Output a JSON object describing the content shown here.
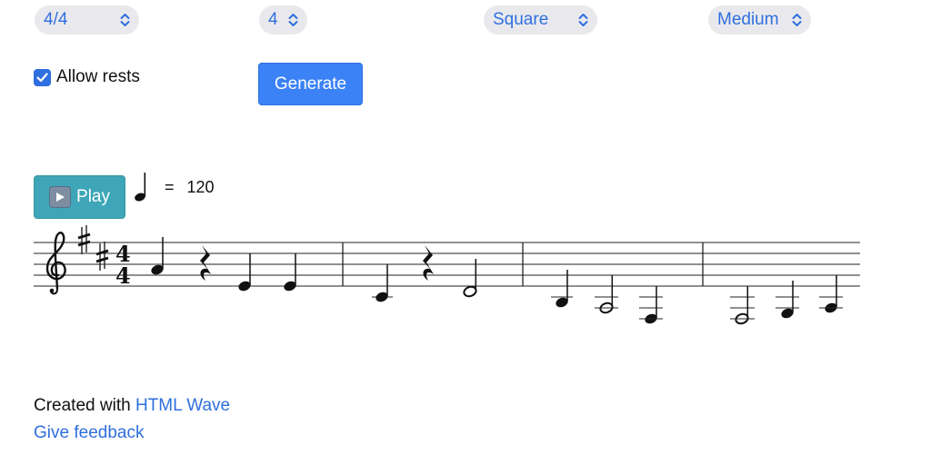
{
  "controls": {
    "time_signature": "4/4",
    "measures": "4",
    "waveform": "Square",
    "difficulty": "Medium",
    "allow_rests_label": "Allow rests",
    "allow_rests_checked": true,
    "generate_label": "Generate"
  },
  "player": {
    "play_label": "Play",
    "tempo_equals": "=",
    "tempo_value": "120"
  },
  "score": {
    "clef": "treble",
    "key_signature": "D major (2 sharps)",
    "time_signature_top": "4",
    "time_signature_bottom": "4",
    "measures": [
      [
        {
          "type": "note",
          "pitch": "A4",
          "duration": "quarter"
        },
        {
          "type": "rest",
          "duration": "quarter"
        },
        {
          "type": "note",
          "pitch": "E4",
          "duration": "quarter"
        },
        {
          "type": "note",
          "pitch": "E4",
          "duration": "quarter"
        }
      ],
      [
        {
          "type": "note",
          "pitch": "C4",
          "duration": "quarter"
        },
        {
          "type": "rest",
          "duration": "quarter"
        },
        {
          "type": "note",
          "pitch": "D4",
          "duration": "half"
        }
      ],
      [
        {
          "type": "note",
          "pitch": "B3",
          "duration": "quarter"
        },
        {
          "type": "note",
          "pitch": "A3",
          "duration": "half"
        },
        {
          "type": "note",
          "pitch": "G3",
          "duration": "quarter"
        }
      ],
      [
        {
          "type": "note",
          "pitch": "G3",
          "duration": "half"
        },
        {
          "type": "note",
          "pitch": "A3",
          "duration": "quarter"
        },
        {
          "type": "note",
          "pitch": "B3",
          "duration": "quarter"
        }
      ]
    ]
  },
  "footer": {
    "created_with_prefix": "Created with",
    "created_with_link": "HTML Wave",
    "feedback_link": "Give feedback"
  },
  "colors": {
    "accent": "#2f6fde",
    "play_button": "#3ea6b8",
    "select_bg": "#e9e9ed"
  }
}
